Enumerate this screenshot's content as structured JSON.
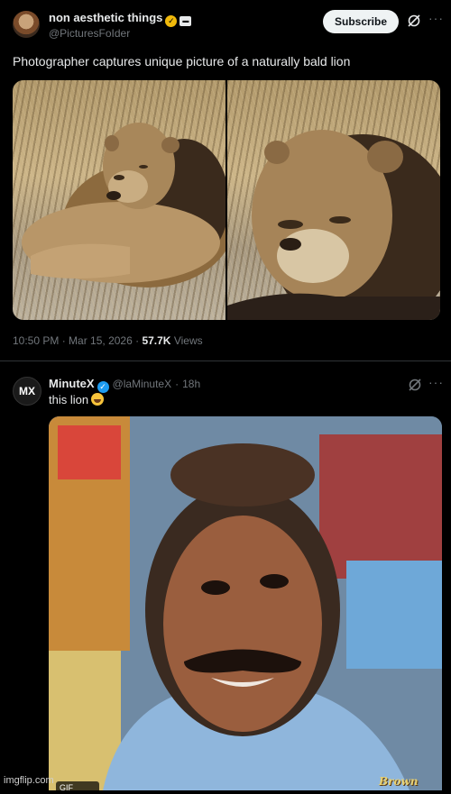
{
  "post": {
    "display_name": "non aesthetic things",
    "handle": "@PicturesFoIder",
    "subscribe_label": "Subscribe",
    "text": "Photographer captures unique picture of a naturally bald lion",
    "time": "10:50 PM",
    "date": "Mar 15, 2026",
    "views_count": "57.7K",
    "views_label": "Views"
  },
  "reply": {
    "display_name": "MinuteX",
    "handle": "@laMinuteX",
    "age": "18h",
    "text": "this lion",
    "emoji": "😂",
    "avatar_text": "MX",
    "gif_badge": "GIF",
    "gif_caption": "Brown"
  },
  "watermark": "imgflip.com",
  "icons": {
    "verified_gold": "verified-badge-gold",
    "verified_blue": "verified-badge-blue",
    "grok": "grok-icon",
    "more": "more-icon"
  },
  "colors": {
    "background": "#000000",
    "text": "#e7e9ea",
    "muted": "#71767b",
    "gold": "#f0b90b",
    "blue": "#1d9bf0"
  }
}
